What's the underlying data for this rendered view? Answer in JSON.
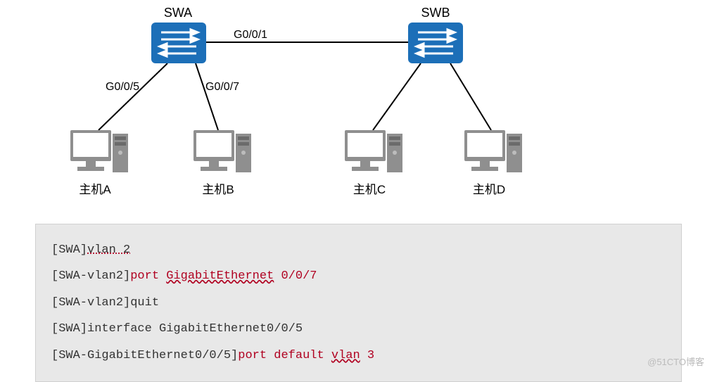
{
  "diagram": {
    "switches": [
      {
        "name": "SWA",
        "label": "SWA"
      },
      {
        "name": "SWB",
        "label": "SWB"
      }
    ],
    "hosts": [
      {
        "name": "A",
        "label": "主机A"
      },
      {
        "name": "B",
        "label": "主机B"
      },
      {
        "name": "C",
        "label": "主机C"
      },
      {
        "name": "D",
        "label": "主机D"
      }
    ],
    "port_labels": {
      "swa_swb": "G0/0/1",
      "swa_hostA": "G0/0/5",
      "swa_hostB": "G0/0/7"
    }
  },
  "cli": {
    "l1_prompt": "[SWA]",
    "l1_cmd": "vlan 2",
    "l2_prompt": "[SWA-vlan2]",
    "l2_cmd_red": "port ",
    "l2_cmd_red2": "GigabitEthernet",
    "l2_cmd_tail": " 0/0/7",
    "l3_prompt": "[SWA-vlan2]",
    "l3_cmd": "quit",
    "l4_prompt": "[SWA]",
    "l4_cmd": "interface GigabitEthernet0/0/5",
    "l5_prompt": "[SWA-GigabitEthernet0/0/5]",
    "l5_cmd_red": "port default ",
    "l5_cmd_red2": "vlan",
    "l5_cmd_tail": " 3"
  },
  "watermark": "@51CTO博客"
}
